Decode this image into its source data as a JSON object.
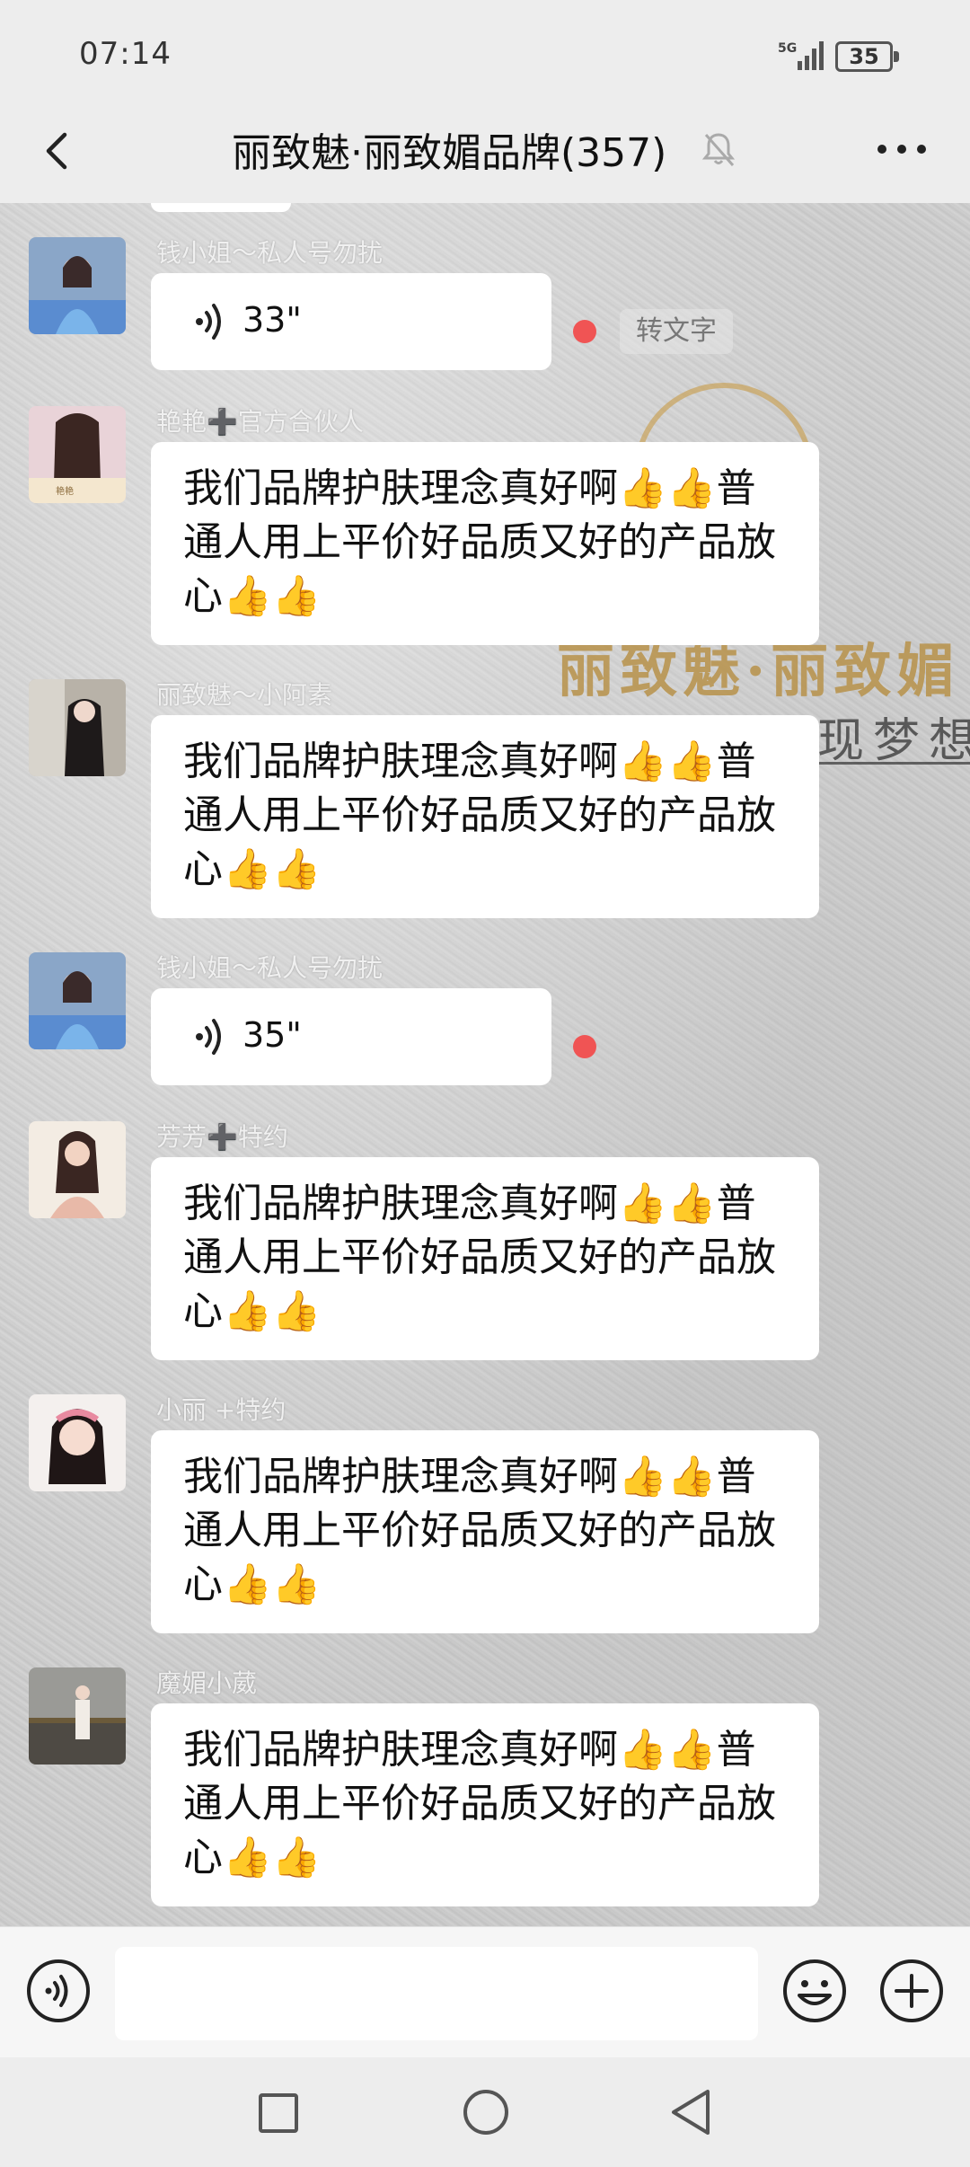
{
  "status_bar": {
    "time": "07:14",
    "network": "5G",
    "battery": "35"
  },
  "header": {
    "title": "丽致魅·丽致媚品牌(357)",
    "back_icon": "chevron-left-icon",
    "mute_icon": "bell-off-icon",
    "more_icon": "more-horizontal-icon"
  },
  "background": {
    "brand_text": "丽致魅·丽致媚",
    "slogan_text": "现梦想"
  },
  "messages": [
    {
      "sender": "钱小姐～私人号勿扰",
      "type": "voice",
      "duration": "33\"",
      "unread": true,
      "to_text_label": "转文字"
    },
    {
      "sender": "艳艳➕官方合伙人",
      "type": "text",
      "text": "我们品牌护肤理念真好啊👍👍普通人用上平价好品质又好的产品放心👍👍"
    },
    {
      "sender": "丽致魅～小阿素",
      "type": "text",
      "text": "我们品牌护肤理念真好啊👍👍普通人用上平价好品质又好的产品放心👍👍"
    },
    {
      "sender": "钱小姐～私人号勿扰",
      "type": "voice",
      "duration": "35\"",
      "unread": true
    },
    {
      "sender": "芳芳➕特约",
      "type": "text",
      "text": "我们品牌护肤理念真好啊👍👍普通人用上平价好品质又好的产品放心👍👍"
    },
    {
      "sender": "小丽 +特约",
      "type": "text",
      "text": "我们品牌护肤理念真好啊👍👍普通人用上平价好品质又好的产品放心👍👍"
    },
    {
      "sender": "魔媚小葳",
      "type": "text",
      "text": "我们品牌护肤理念真好啊👍👍普通人用上平价好品质又好的产品放心👍👍"
    }
  ],
  "input_bar": {
    "voice_icon": "voice-toggle-icon",
    "emoji_icon": "smile-icon",
    "plus_icon": "plus-circle-icon",
    "placeholder": ""
  },
  "nav_bar": {
    "icons": [
      "recent-apps-icon",
      "home-icon",
      "back-icon"
    ]
  },
  "colors": {
    "background": "#ededed",
    "bubble": "#ffffff",
    "unread_dot": "#f05454",
    "brand_gold": "#b8924a"
  }
}
